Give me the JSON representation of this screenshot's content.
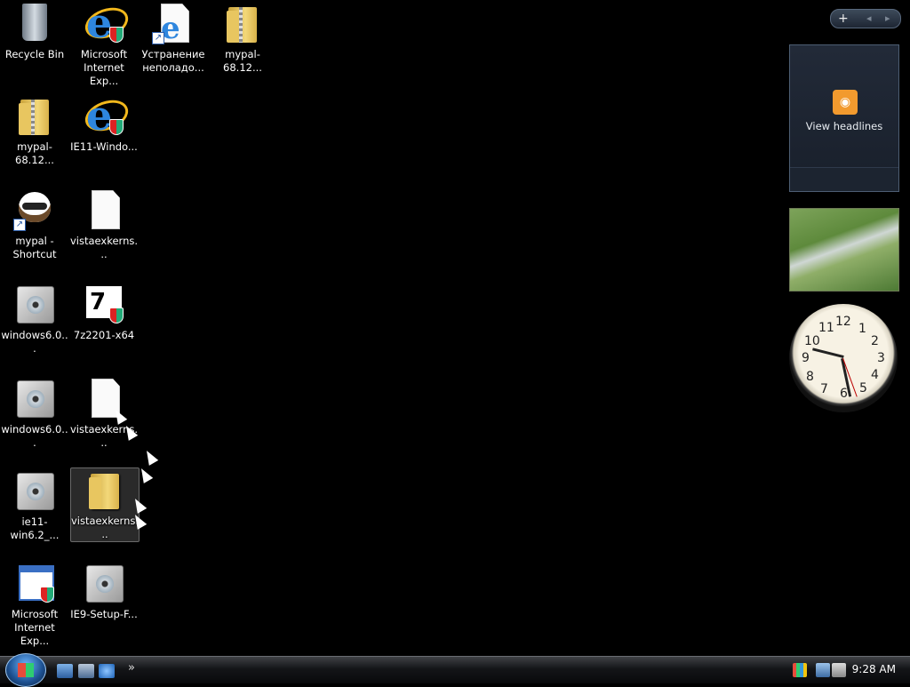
{
  "desktop_icons": [
    {
      "label": "Recycle Bin"
    },
    {
      "label": "Microsoft Internet Exp..."
    },
    {
      "label": "Устранение неполадо..."
    },
    {
      "label": "mypal-68.12..."
    },
    {
      "label": "mypal-68.12..."
    },
    {
      "label": "IE11-Windo..."
    },
    {
      "label": "mypal - Shortcut"
    },
    {
      "label": "vistaexkerns..."
    },
    {
      "label": "windows6.0..."
    },
    {
      "label": "7z2201-x64"
    },
    {
      "label": "windows6.0..."
    },
    {
      "label": "vistaexkerns..."
    },
    {
      "label": "ie11-win6.2_..."
    },
    {
      "label": "vistaexkerns..."
    },
    {
      "label": "Microsoft Internet Exp..."
    },
    {
      "label": "IE9-Setup-F..."
    }
  ],
  "sidebar": {
    "plus_label": "+",
    "nav_label": "◂ ▸",
    "feed_gadget": {
      "text": "View headlines"
    }
  },
  "clock_gadget": {
    "numbers": [
      "12",
      "1",
      "2",
      "3",
      "4",
      "5",
      "6",
      "7",
      "8",
      "9",
      "10",
      "11"
    ]
  },
  "taskbar": {
    "quicklaunch_more": "»",
    "time": "9:28 AM"
  }
}
